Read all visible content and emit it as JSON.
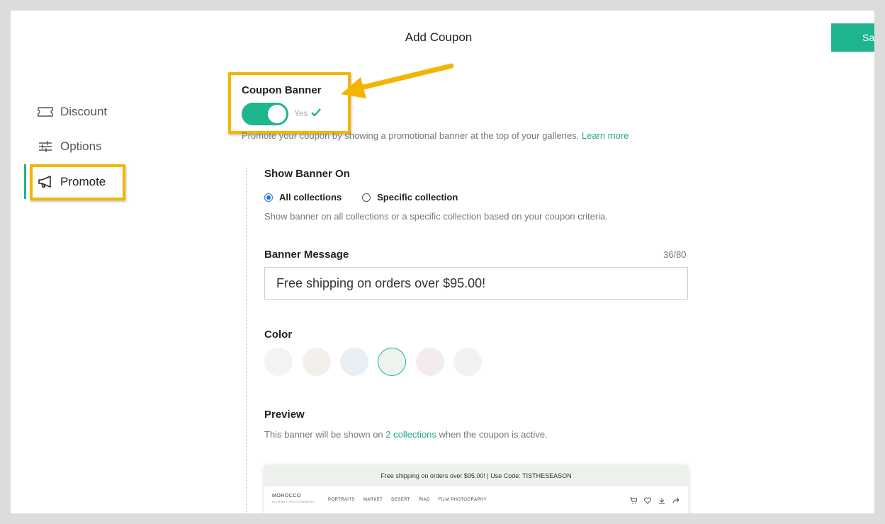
{
  "header": {
    "title": "Add Coupon",
    "save_label": "Sa"
  },
  "sidebar": {
    "items": [
      {
        "label": "Discount",
        "icon": "ticket-icon"
      },
      {
        "label": "Options",
        "icon": "sliders-icon"
      },
      {
        "label": "Promote",
        "icon": "megaphone-icon",
        "active": true
      }
    ]
  },
  "coupon_banner": {
    "label": "Coupon Banner",
    "toggle_state": "Yes",
    "enabled": true,
    "description": "Promote your coupon by showing a promotional banner at the top of your galleries.",
    "learn_more": "Learn more"
  },
  "show_banner_on": {
    "label": "Show Banner On",
    "options": [
      "All collections",
      "Specific collection"
    ],
    "selected": "All collections",
    "help": "Show banner on all collections or a specific collection based on your coupon criteria."
  },
  "banner_message": {
    "label": "Banner Message",
    "counter": "36/80",
    "value": "Free shipping on orders over $95.00!"
  },
  "color": {
    "label": "Color",
    "swatches": [
      "#f3f3f3",
      "#f3f0ec",
      "#e8eff4",
      "#eef3ee",
      "#f4ecec",
      "#f2f2f2"
    ],
    "selected_index": 3
  },
  "preview": {
    "label": "Preview",
    "text_before": "This banner will be shown on",
    "collections_link": "2 collections",
    "text_after": "when the coupon is active.",
    "banner_text": "Free shipping on orders over $95.00!  |  Use Code: TISTHESEASON",
    "site_name": "MOROCCO",
    "site_sub": "PIXIESET PHOTOGRAPHY",
    "menu": [
      "PORTRAITS",
      "MARKET",
      "DESERT",
      "RIAD",
      "FILM PHOTOGRAPHY"
    ]
  },
  "colors": {
    "accent": "#1fb58f",
    "highlight": "#f3b500",
    "link": "#1fa88a"
  }
}
